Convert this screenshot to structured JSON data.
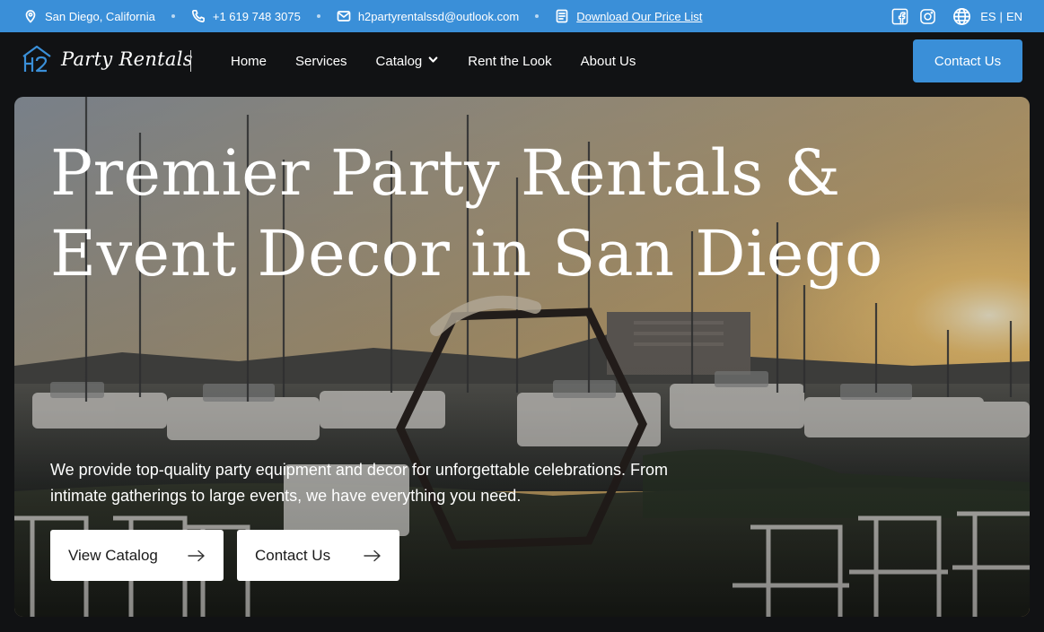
{
  "topbar": {
    "location": "San Diego, California",
    "phone": "+1 619 748 3075",
    "email": "h2partyrentalssd@outlook.com",
    "price_list_link": "Download Our Price List",
    "lang_es": "ES",
    "lang_sep": "|",
    "lang_en": "EN"
  },
  "nav": {
    "logo_mark": "H2",
    "logo_text": "Party Rentals",
    "items": [
      "Home",
      "Services",
      "Catalog",
      "Rent the Look",
      "About Us"
    ],
    "cta": "Contact Us"
  },
  "hero": {
    "title_line1": "Premier Party Rentals &",
    "title_line2": "Event Decor in San Diego",
    "description_line1": "We provide top-quality party equipment and decor for unforgettable celebrations. From",
    "description_line2": "intimate gatherings to large events, we have everything you need.",
    "btn_catalog": "View Catalog",
    "btn_contact": "Contact Us"
  },
  "colors": {
    "accent": "#3a8fd8",
    "nav_bg": "#111214"
  },
  "icons": [
    "location-pin-icon",
    "phone-icon",
    "email-icon",
    "document-icon",
    "facebook-icon",
    "instagram-icon",
    "globe-icon",
    "chevron-down-icon",
    "arrow-right-icon"
  ]
}
